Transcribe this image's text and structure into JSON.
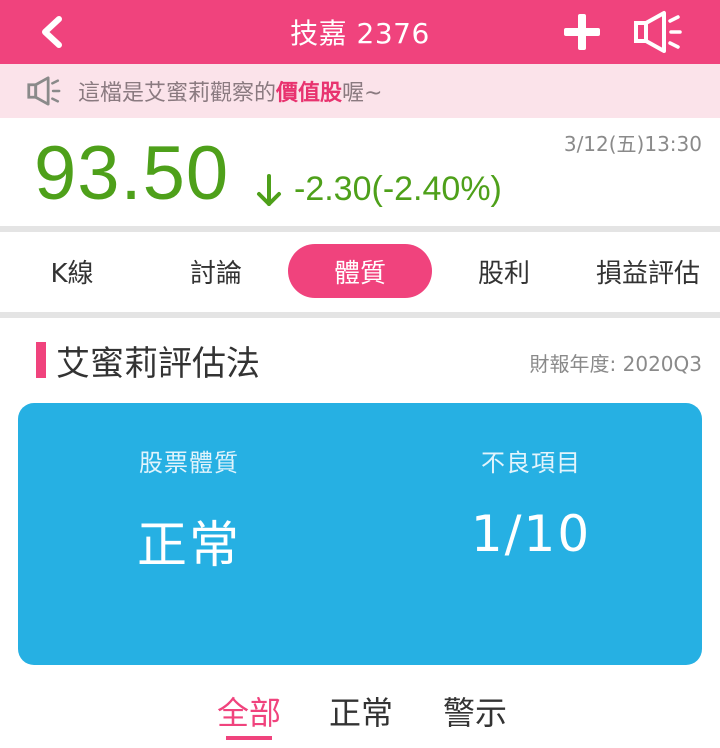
{
  "appbar": {
    "title": "技嘉 2376",
    "back_icon": "chevron-left-icon",
    "add_icon": "plus-icon",
    "speaker_icon": "megaphone-icon"
  },
  "notice": {
    "icon": "megaphone-icon",
    "text_before": "這檔是艾蜜莉觀察的",
    "highlight": "價值股",
    "text_after": "喔~"
  },
  "quote": {
    "price": "93.50",
    "change": "-2.30(-2.40%)",
    "direction_icon": "arrow-down-icon",
    "timestamp": "3/12(五)13:30"
  },
  "tabs": [
    {
      "label": "K線",
      "active": false
    },
    {
      "label": "討論",
      "active": false
    },
    {
      "label": "體質",
      "active": true
    },
    {
      "label": "股利",
      "active": false
    },
    {
      "label": "損益評估",
      "active": false
    }
  ],
  "section": {
    "title": "艾蜜莉評估法",
    "report_label": "財報年度: 2020Q3"
  },
  "card": {
    "left_label": "股票體質",
    "left_value": "正常",
    "right_label": "不良項目",
    "right_value": "1/10"
  },
  "filters": [
    {
      "label": "全部",
      "active": true
    },
    {
      "label": "正常",
      "active": false
    },
    {
      "label": "警示",
      "active": false
    }
  ],
  "colors": {
    "brand": "#f0437d",
    "price_down": "#4ea01a",
    "card": "#26b0e3"
  }
}
